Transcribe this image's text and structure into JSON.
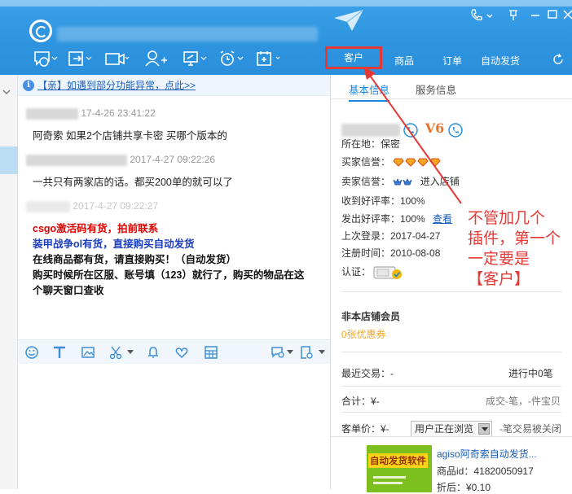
{
  "header": {
    "toolbar_tabs": [
      "客户",
      "商品",
      "订单",
      "自动发货"
    ]
  },
  "chat": {
    "notice": "【亲】如遇到部分功能异常，点此>>",
    "messages": [
      {
        "time": "17-4-26 23:41:22",
        "text": "阿奇索  如果2个店铺共享卡密  买哪个版本的"
      },
      {
        "time": "2017-4-27 09:22:26",
        "text": "一共只有两家店的话。都买200单的就可以了"
      },
      {
        "time": "2017-4-27 09:22:27",
        "lines": [
          "csgo激活码有货，拍前联系",
          "装甲战争ol有货，直接购买自动发货",
          "在线商品都有货，请直接购买！（自动发货）",
          "购买时候所在区服、账号填（123）就行了，购买的物品在这",
          "个聊天窗口查收"
        ]
      }
    ]
  },
  "right": {
    "tabs": [
      "基本信息",
      "服务信息"
    ],
    "level": "V6",
    "location": "所在地：保密",
    "buyer_credit": "买家信誉：",
    "seller_credit": "卖家信誉：",
    "enter_shop": "进入店铺",
    "received_rate": "收到好评率：100%",
    "sent_rate": "发出好评率：100%",
    "view": "查看",
    "last_login": "上次登录：2017-04-27",
    "register": "注册时间：2010-08-08",
    "auth": "认证：",
    "membership": "非本店铺会员",
    "coupons": "0张优惠券",
    "recent_trade_label": "最近交易：-",
    "in_progress": "进行中0笔",
    "total_label": "合计：¥-",
    "total_detail": "成交-笔，-件宝贝",
    "avg_label": "客单价：¥-",
    "browse_label": "用户正在浏览",
    "closed": "-笔交易被关闭",
    "product": {
      "title": "agiso阿奇索自动发货...",
      "id": "商品id：41820050917",
      "discount": "折后：¥0.10",
      "image_tag": "自动发货软件"
    }
  },
  "annotation": {
    "lines": [
      "不管加几个",
      "插件，第一个",
      "一定要是",
      "【客户】"
    ]
  },
  "colors": {
    "header_blue": "#2f95e0",
    "highlight_red": "#e53935",
    "link_blue": "#1a86e0"
  }
}
